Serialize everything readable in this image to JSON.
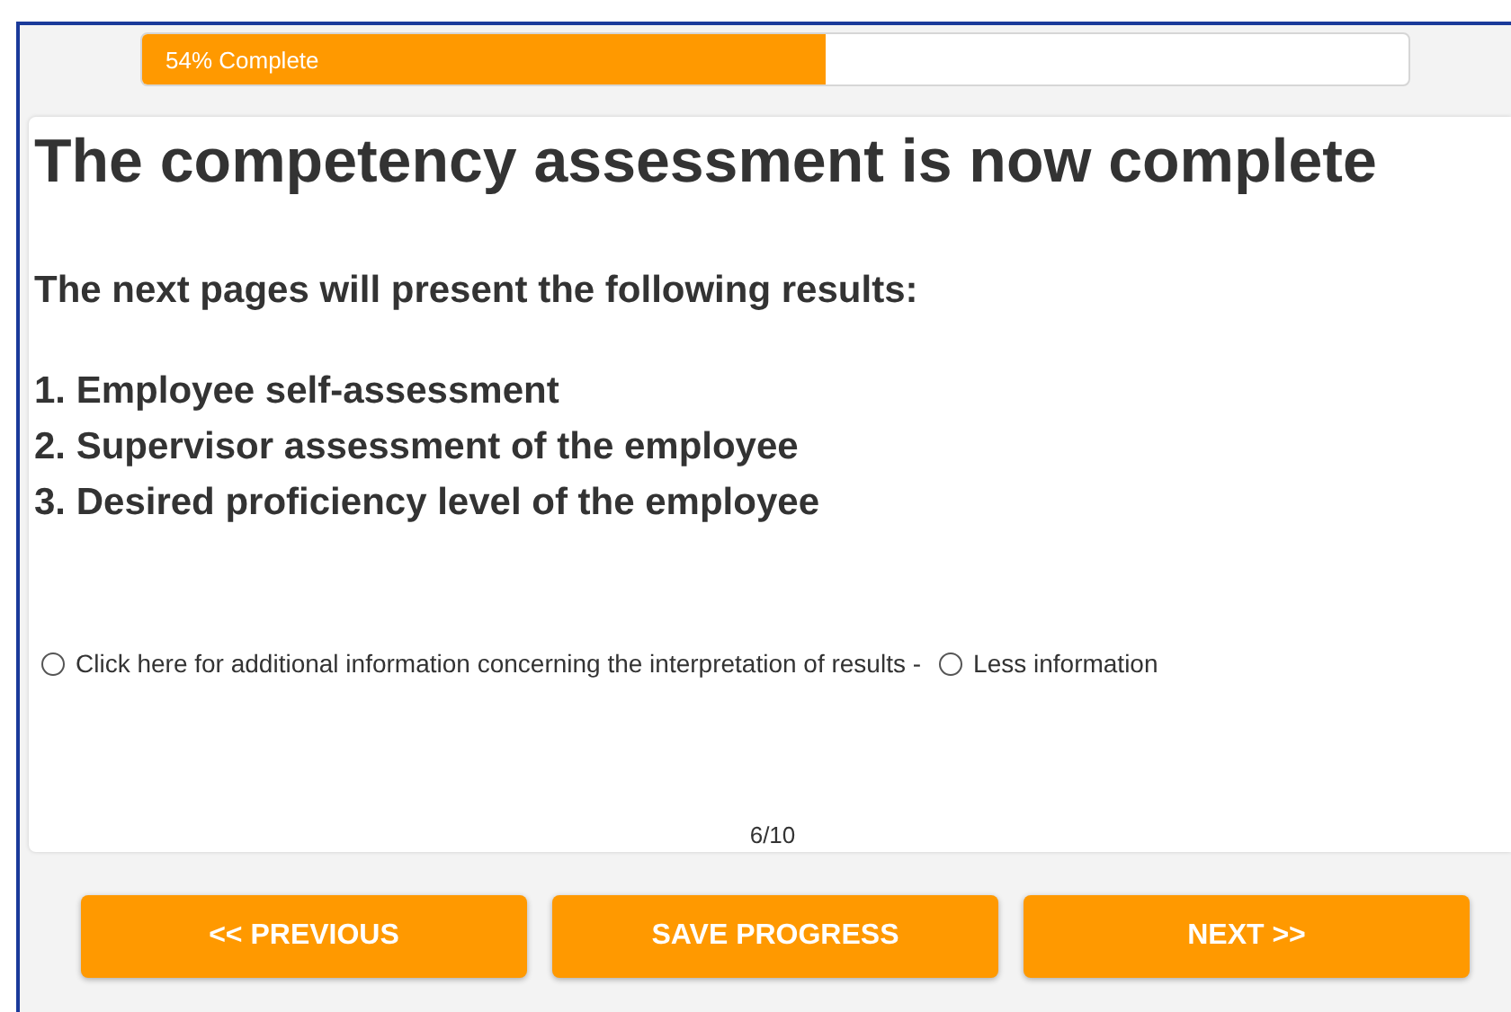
{
  "progress": {
    "label": "54% Complete",
    "level": 0.54
  },
  "heading": "The competency assessment is now complete",
  "intro": "The next pages will present the following results:",
  "results": [
    "1. Employee self-assessment",
    "2. Supervisor assessment of the employee",
    "3. Desired proficiency level of the employee"
  ],
  "options": [
    {
      "label": "Click here for additional information concerning the interpretation of results -",
      "selected": false
    },
    {
      "label": "Less information",
      "selected": false
    }
  ],
  "page_indicator": "6/10",
  "buttons": [
    "<< PREVIOUS",
    "SAVE PROGRESS",
    "NEXT >>"
  ]
}
